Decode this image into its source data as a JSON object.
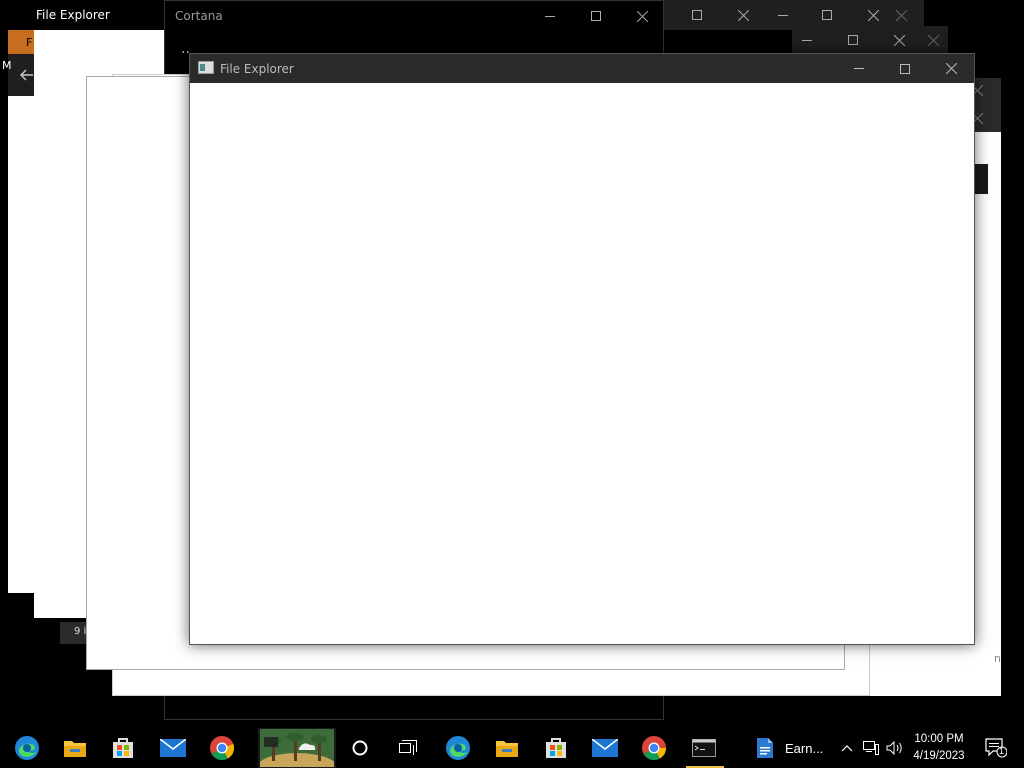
{
  "windows": {
    "cortana": {
      "title": "Cortana",
      "dots": "··"
    },
    "file_explorer_back": {
      "title": "File Explorer",
      "menu_stub": "F",
      "side_letter": "M",
      "status_stub": "9 i"
    },
    "file_explorer_front": {
      "title": "File Explorer"
    },
    "right_stub": {
      "text": "n"
    }
  },
  "taskbar": {
    "pinned": [
      "edge-icon",
      "file-explorer-icon",
      "store-icon",
      "mail-icon",
      "chrome-icon",
      "weather-widget-icon",
      "cortana-icon",
      "task-view-icon",
      "edge-icon",
      "file-explorer-icon",
      "store-icon",
      "mail-icon",
      "chrome-icon",
      "terminal-icon"
    ],
    "app_button_label": "Earn...",
    "clock_time": "10:00 PM",
    "clock_date": "4/19/2023",
    "notification_count": "1"
  },
  "colors": {
    "accent": "#0078d4",
    "titlebar_dark": "#202020",
    "titlebar_active": "#2b2b2b"
  }
}
